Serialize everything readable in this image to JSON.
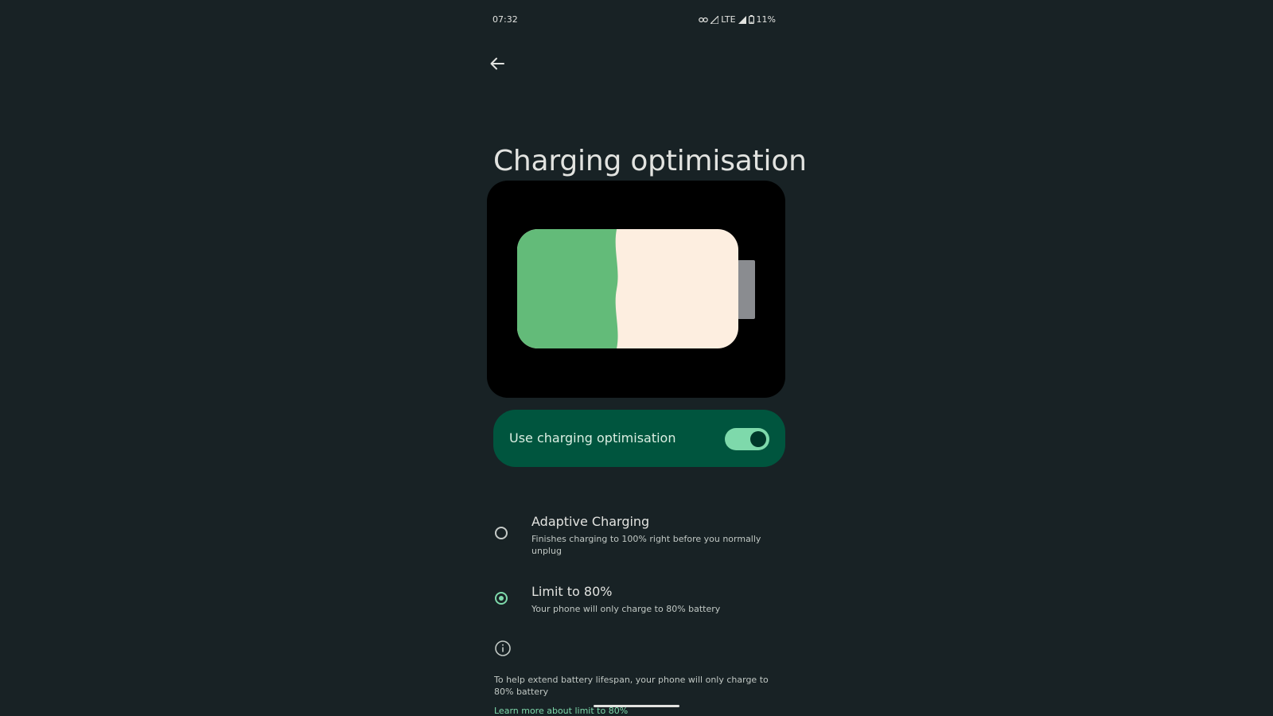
{
  "status_bar": {
    "time": "07:32",
    "network": "LTE",
    "battery": "11%",
    "icons": [
      "link-icon",
      "signal-icon",
      "signal-icon",
      "battery-icon"
    ]
  },
  "header": {
    "back_icon": "arrow-left-icon",
    "title": "Charging optimisation"
  },
  "illustration": {
    "charge_level": 0.45,
    "fill_color": "#63bb79",
    "empty_color": "#fdeee0",
    "terminal_color": "#8a8c90"
  },
  "main_toggle": {
    "label": "Use charging optimisation",
    "checked": true,
    "card_color": "#00553e",
    "accent": "#7ed9ab"
  },
  "options": [
    {
      "title": "Adaptive Charging",
      "subtitle": "Finishes charging to 100% right before you normally unplug",
      "selected": false
    },
    {
      "title": "Limit to 80%",
      "subtitle": "Your phone will only charge to 80% battery",
      "selected": true
    }
  ],
  "info": {
    "icon": "info-icon",
    "text": "To help extend battery lifespan, your phone will only charge to 80% battery",
    "link": "Learn more about limit to 80%"
  },
  "colors": {
    "background": "#182225",
    "text": "#e2e3e0",
    "secondary_text": "#c1c8c4"
  }
}
